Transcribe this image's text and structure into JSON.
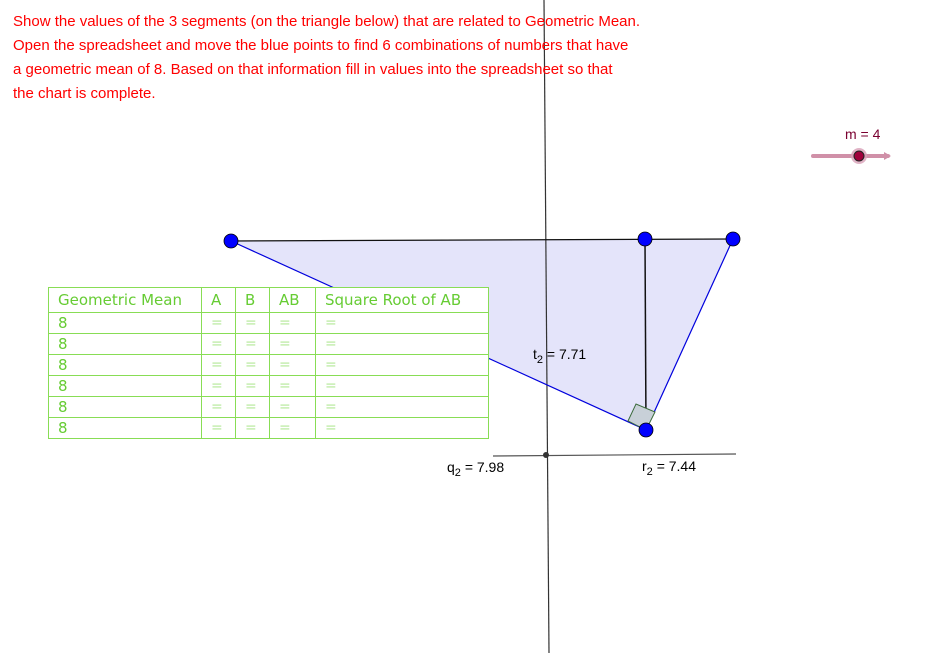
{
  "instructions": {
    "lines": [
      "Show the values of the 3 segments (on the triangle below) that are related to Geometric Mean.",
      "Open the spreadsheet and move the blue points to find 6 combinations of numbers that have",
      "a geometric mean of 8. Based on that information fill in values into the spreadsheet so that",
      "the chart is complete."
    ],
    "color": "#ff0000"
  },
  "slider": {
    "label": "m = 4",
    "name": "m",
    "value": 4,
    "color": "#c06080"
  },
  "measurements": {
    "t2": {
      "name": "t",
      "sub": "2",
      "value": "= 7.71"
    },
    "q2": {
      "name": "q",
      "sub": "2",
      "value": "= 7.98"
    },
    "r2": {
      "name": "r",
      "sub": "2",
      "value": "= 7.44"
    }
  },
  "colors": {
    "point": "#0000ff",
    "triangle_fill": "#e4e4fa",
    "triangle_edge": "#0000dd",
    "table_text": "#66cc33",
    "table_border": "#88dd55"
  },
  "table": {
    "headers": [
      "Geometric Mean",
      "A",
      "B",
      "AB",
      "Square Root of AB"
    ],
    "rows": [
      [
        "8",
        "=",
        "=",
        "=",
        "="
      ],
      [
        "8",
        "=",
        "=",
        "=",
        "="
      ],
      [
        "8",
        "=",
        "=",
        "=",
        "="
      ],
      [
        "8",
        "=",
        "=",
        "=",
        "="
      ],
      [
        "8",
        "=",
        "=",
        "=",
        "="
      ],
      [
        "8",
        "=",
        "=",
        "=",
        "="
      ]
    ]
  }
}
